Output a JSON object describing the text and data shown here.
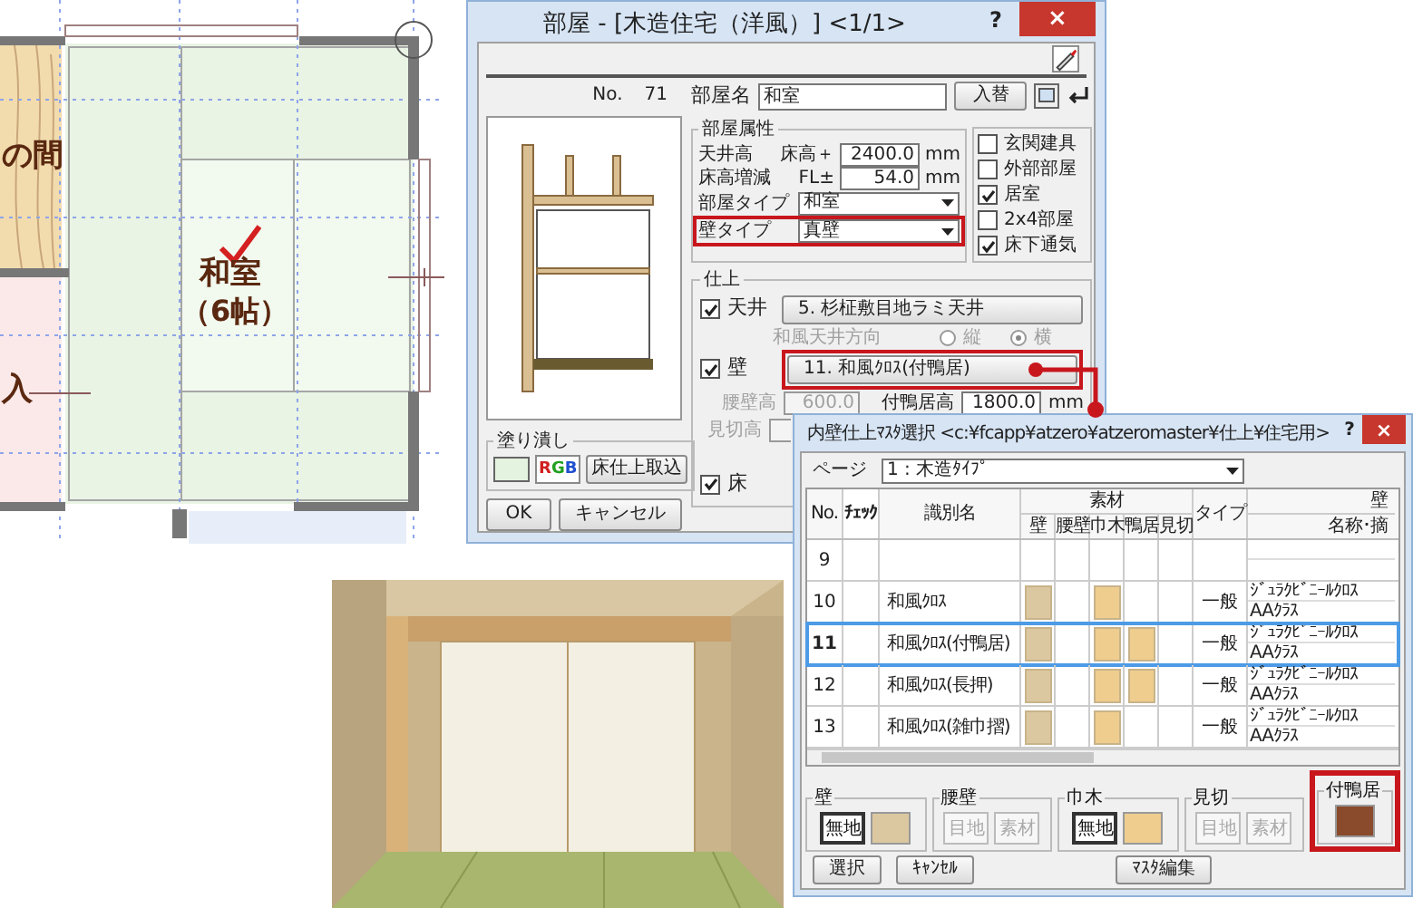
{
  "floor_plan": {
    "left_room": "の間",
    "room_name": "和室",
    "room_size": "（6帖）",
    "entrance": "入"
  },
  "room_dialog": {
    "title": "部屋 - [木造住宅（洋風）]  <1/1>",
    "help": "?",
    "close": "×",
    "no_label": "No.",
    "no_value": "71",
    "name_label": "部屋名",
    "name_value": "和室",
    "replace_button": "入替",
    "attributes": {
      "title": "部屋属性",
      "ceiling_label": "天井高",
      "ceiling_ref": "床高＋",
      "ceiling_value": "2400.0",
      "ceiling_unit": "mm",
      "floor_label": "床高増減",
      "floor_ref": "FL±",
      "floor_value": "54.0",
      "floor_unit": "mm",
      "room_type_label": "部屋タイプ",
      "room_type_value": "和室",
      "wall_type_label": "壁タイプ",
      "wall_type_value": "真壁"
    },
    "flags": [
      {
        "label": "玄関建具",
        "checked": false
      },
      {
        "label": "外部部屋",
        "checked": false
      },
      {
        "label": "居室",
        "checked": true
      },
      {
        "label": "2x4部屋",
        "checked": false
      },
      {
        "label": "床下通気",
        "checked": true
      }
    ],
    "finish": {
      "title": "仕上",
      "ceiling": {
        "label": "天井",
        "checked": true,
        "button": "5. 杉柾敷目地ラミ天井"
      },
      "ceiling_direction": {
        "label": "和風天井方向",
        "disabled": true,
        "options": [
          {
            "label": "縦",
            "selected": false
          },
          {
            "label": "横",
            "selected": true
          }
        ]
      },
      "wall": {
        "label": "壁",
        "checked": true,
        "button": "11. 和風ｸﾛｽ(付鴨居)"
      },
      "wainscot": {
        "label": "腰壁高",
        "value": "600.0",
        "disabled": true
      },
      "lintel": {
        "label": "付鴨居高",
        "value": "1800.0",
        "unit": "mm",
        "disabled": false
      },
      "trim": {
        "label": "見切高",
        "disabled": true
      },
      "floor": {
        "label": "床",
        "checked": true
      }
    },
    "fill": {
      "title": "塗り潰し",
      "rgb": "RGB",
      "import_button": "床仕上取込"
    },
    "buttons": [
      "OK",
      "キャンセル"
    ]
  },
  "master_dialog": {
    "title": "内壁仕上ﾏｽﾀ選択 <c:¥fcapp¥atzero¥atzeromaster¥仕上¥住宅用>",
    "help": "?",
    "close": "×",
    "page_label": "ページ",
    "page_value": "1 : 木造ﾀｲﾌﾟ",
    "columns": [
      "No.",
      "ﾁｪｯｸ",
      "識別名",
      "素材",
      "タイプ",
      "壁"
    ],
    "material_columns": [
      "壁",
      "腰壁",
      "巾木",
      "鴨居",
      "見切"
    ],
    "last_sub_column": "名称･摘",
    "rows": [
      {
        "no": "9",
        "materials": [
          false,
          false,
          false,
          false,
          false
        ],
        "selected": false
      },
      {
        "no": "10",
        "name": "和風ｸﾛｽ",
        "materials": [
          true,
          false,
          true,
          false,
          false
        ],
        "type": "一般",
        "spec": "ｼﾞｭﾗｸﾋﾞﾆｰﾙｸﾛｽ",
        "grade": "AAｸﾗｽ",
        "selected": false
      },
      {
        "no": "11",
        "name": "和風ｸﾛｽ(付鴨居)",
        "materials": [
          true,
          false,
          true,
          true,
          false
        ],
        "type": "一般",
        "spec": "ｼﾞｭﾗｸﾋﾞﾆｰﾙｸﾛｽ",
        "grade": "AAｸﾗｽ",
        "selected": true
      },
      {
        "no": "12",
        "name": "和風ｸﾛｽ(長押)",
        "materials": [
          true,
          false,
          true,
          true,
          false
        ],
        "type": "一般",
        "spec": "ｼﾞｭﾗｸﾋﾞﾆｰﾙｸﾛｽ",
        "grade": "AAｸﾗｽ",
        "selected": false
      },
      {
        "no": "13",
        "name": "和風ｸﾛｽ(雑巾摺)",
        "materials": [
          true,
          false,
          true,
          false,
          false
        ],
        "type": "一般",
        "spec": "ｼﾞｭﾗｸﾋﾞﾆｰﾙｸﾛｽ",
        "grade": "AAｸﾗｽ",
        "selected": false
      }
    ],
    "groups": [
      {
        "label": "壁",
        "disabled": false,
        "buttons": [
          {
            "text": "無地",
            "selected": true
          }
        ],
        "color": "#dcc8a0"
      },
      {
        "label": "腰壁",
        "disabled": true,
        "buttons": [
          {
            "text": "目地",
            "selected": false
          },
          {
            "text": "素材",
            "selected": false
          }
        ]
      },
      {
        "label": "巾木",
        "disabled": false,
        "buttons": [
          {
            "text": "無地",
            "selected": true
          }
        ],
        "color": "#efcd8e"
      },
      {
        "label": "見切",
        "disabled": true,
        "buttons": [
          {
            "text": "目地",
            "selected": false
          },
          {
            "text": "素材",
            "selected": false
          }
        ]
      },
      {
        "label": "付鴨居",
        "color": "#8a4a2c"
      }
    ],
    "buttons": [
      "選択",
      "ｷｬﾝｾﾙ",
      "ﾏｽﾀ編集"
    ]
  }
}
